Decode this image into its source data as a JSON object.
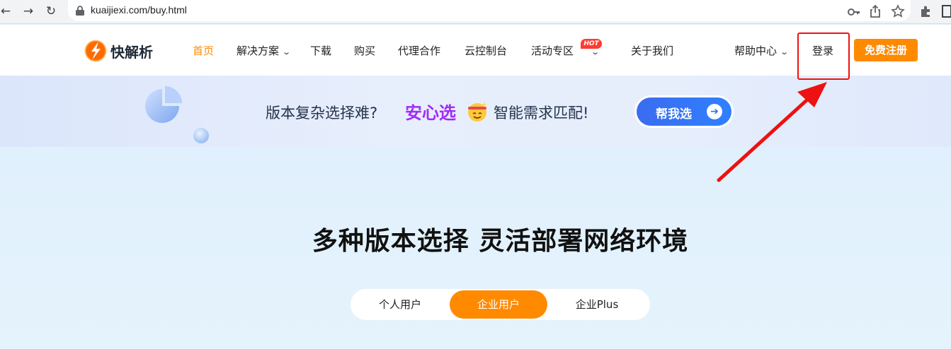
{
  "browser": {
    "back_icon": "back-arrow-icon",
    "forward_icon": "forward-arrow-icon",
    "reload_icon": "reload-icon",
    "url": "kuaijiexi.com/buy.html",
    "right_icons": [
      "key-icon",
      "share-icon",
      "star-icon",
      "extensions-icon",
      "window-icon"
    ]
  },
  "header": {
    "logo_text": "快解析",
    "nav": [
      {
        "label": "首页",
        "active": true
      },
      {
        "label": "解决方案",
        "dropdown": true
      },
      {
        "label": "下载"
      },
      {
        "label": "购买"
      },
      {
        "label": "代理合作"
      },
      {
        "label": "云控制台"
      },
      {
        "label": "活动专区",
        "dropdown": true,
        "badge": "HOT"
      },
      {
        "label": "关于我们"
      },
      {
        "label": "帮助中心",
        "dropdown": true
      }
    ],
    "login_label": "登录",
    "register_label": "免费注册",
    "chevron": "⌄"
  },
  "banner": {
    "text_before": "版本复杂选择难?",
    "highlight": "安心选",
    "text_after": "智能需求匹配!",
    "cta_label": "帮我选",
    "cta_icon": "➔"
  },
  "main": {
    "headline": "多种版本选择 灵活部署网络环境",
    "tabs": [
      {
        "label": "个人用户",
        "active": false
      },
      {
        "label": "企业用户",
        "active": true
      },
      {
        "label": "企业Plus",
        "active": false
      }
    ]
  },
  "colors": {
    "accent": "#ff8a00",
    "annotation": "#ee1111",
    "highlight_purple": "#a12cf5",
    "cta_blue": "#2f80ff"
  }
}
